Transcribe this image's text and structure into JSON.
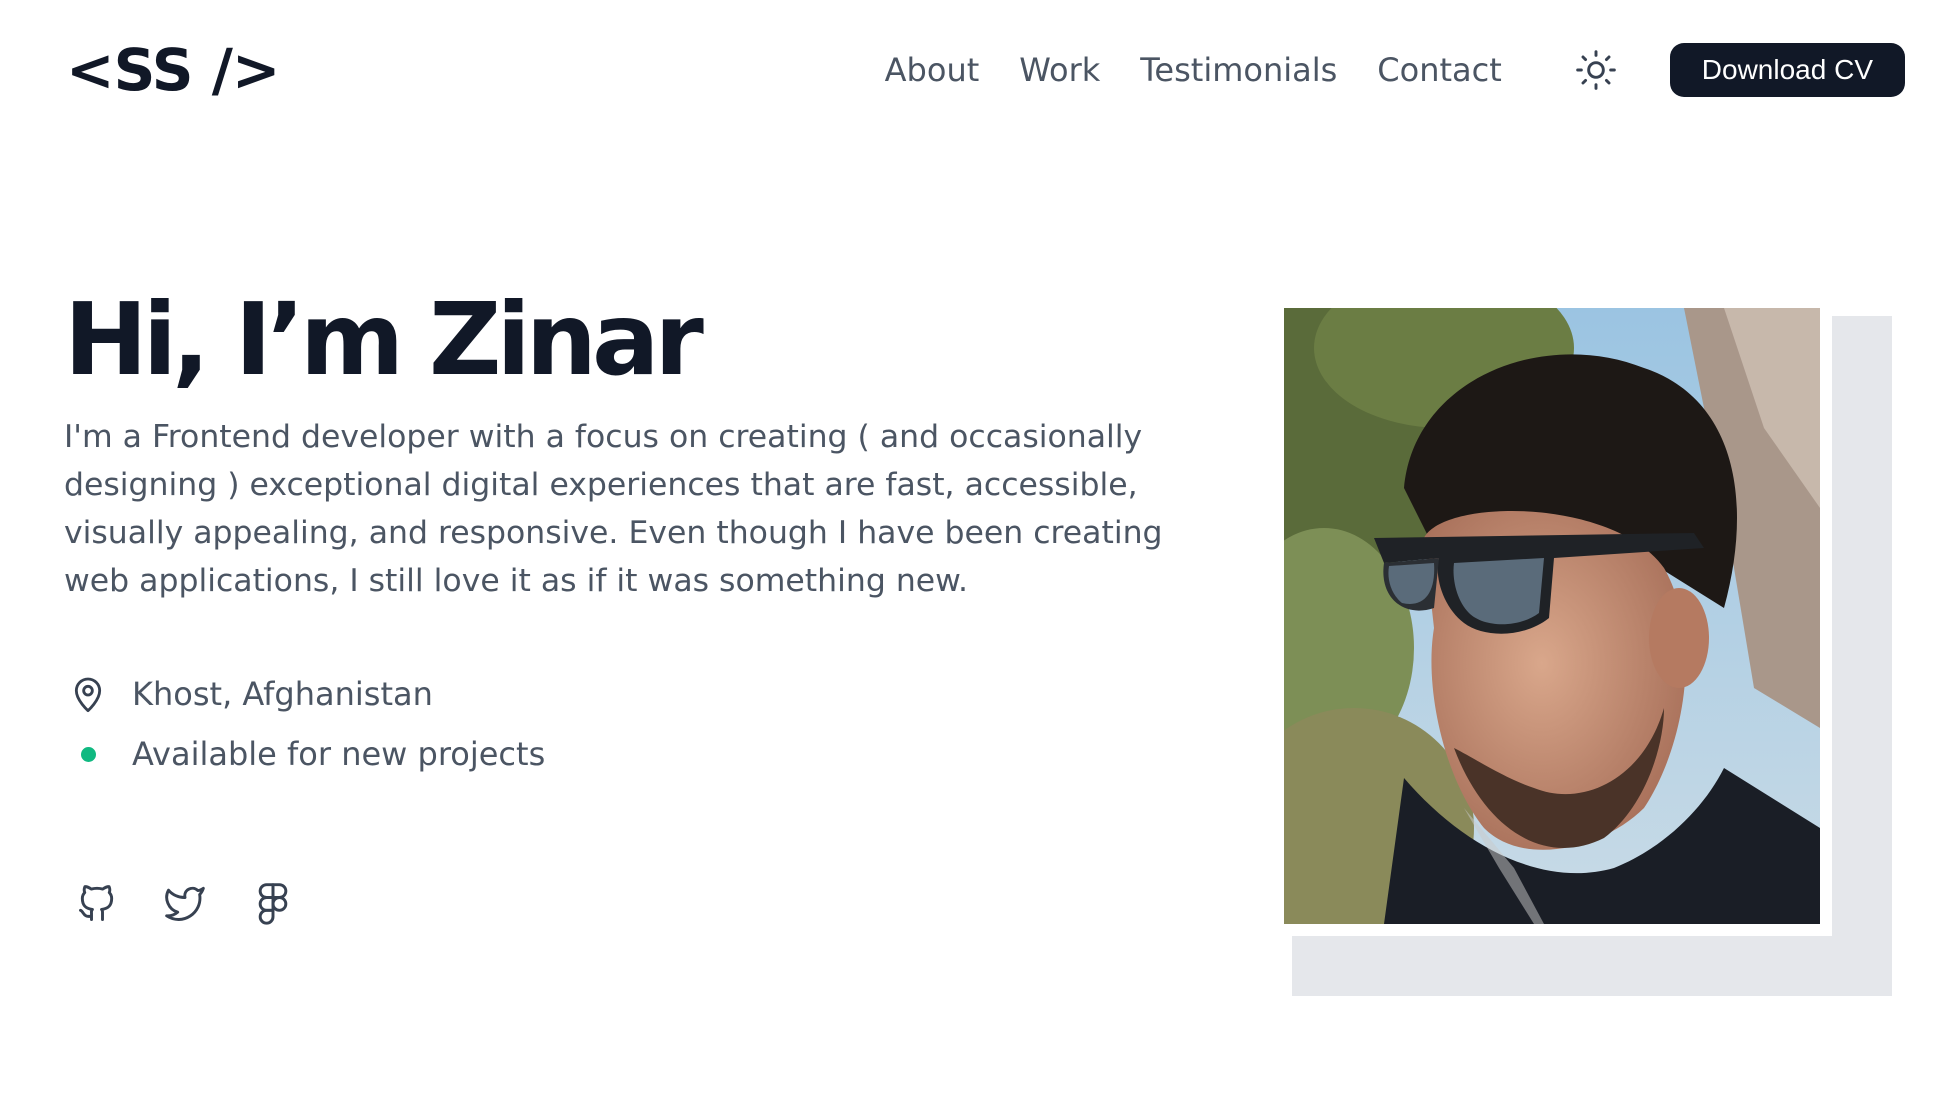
{
  "header": {
    "logo": "<SS />",
    "nav": [
      "About",
      "Work",
      "Testimonials",
      "Contact"
    ],
    "theme_icon": "sun-icon",
    "cv_button": "Download CV"
  },
  "hero": {
    "title": "Hi, I’m Zinar",
    "description": "I'm a Frontend developer with a focus on creating ( and occasionally designing ) exceptional digital experiences that are fast, accessible, visually appealing, and responsive. Even though I have been creating web applications, I still love it as if it was something new.",
    "location": "Khost, Afghanistan",
    "status": "Available for new projects",
    "status_color": "#10b981"
  },
  "socials": [
    "github-icon",
    "twitter-icon",
    "figma-icon"
  ],
  "colors": {
    "primary": "#111827",
    "text_muted": "#4b5563",
    "backdrop": "#e5e7eb"
  }
}
